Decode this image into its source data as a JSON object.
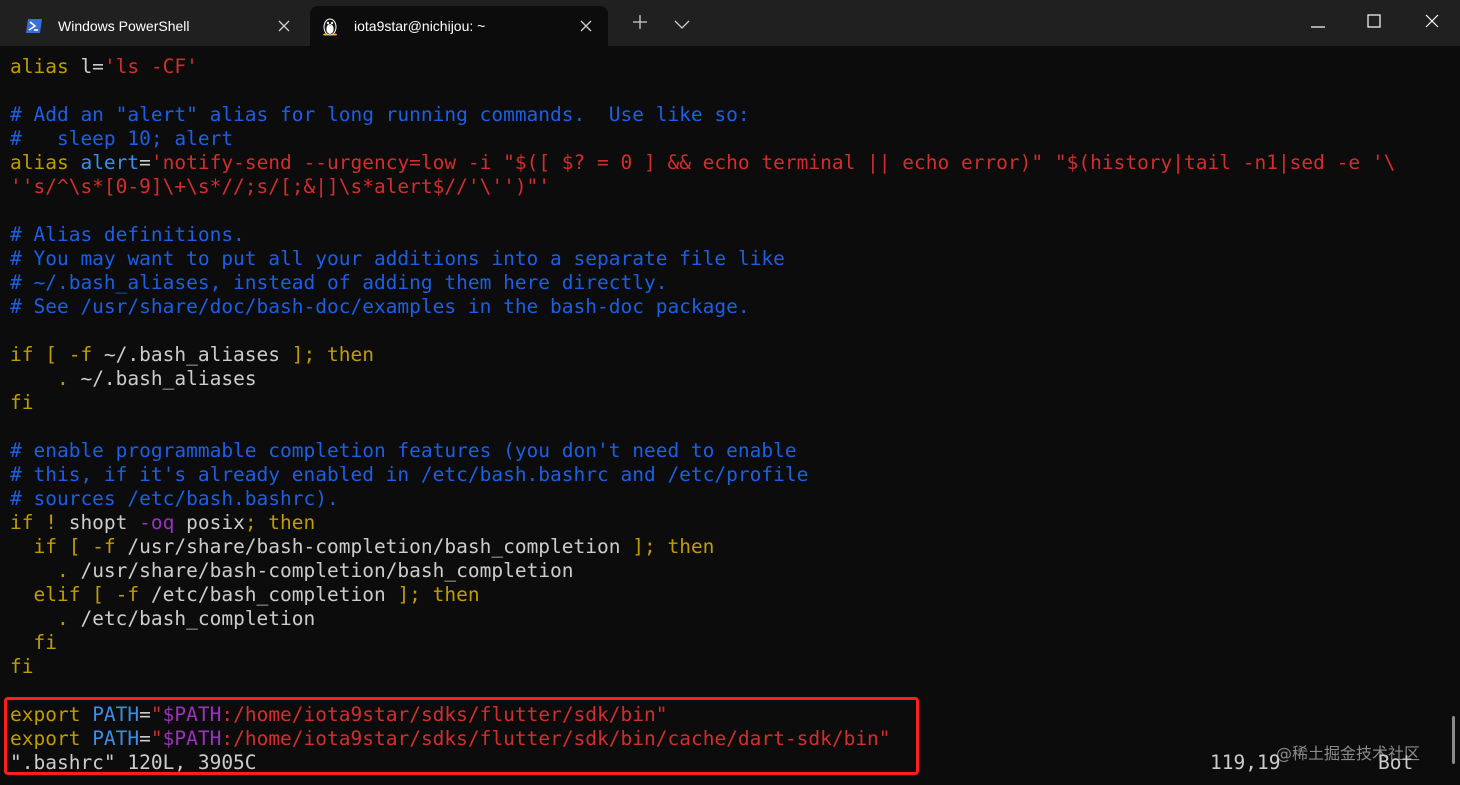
{
  "tabs": [
    {
      "label": "Windows PowerShell",
      "icon": "powershell-icon"
    },
    {
      "label": "iota9star@nichijou: ~",
      "icon": "linux-tux-icon"
    }
  ],
  "colors": {
    "comment": "#1b5fe6",
    "keyword": "#c19c00",
    "string": "#d42d2d",
    "variable": "#9a33c0",
    "identifier": "#3b8eea",
    "text": "#cccccc",
    "highlight_box": "#ff1e1e",
    "background": "#0c0c0c",
    "titlebar": "#202020"
  },
  "code": {
    "l1": {
      "kw": "alias",
      "name": " l=",
      "str": "'ls -CF'"
    },
    "l2": {
      "text": "# Add an \"alert\" alias for long running commands.  Use like so:"
    },
    "l3": {
      "text": "#   sleep 10; alert"
    },
    "l4": {
      "kw": "alias ",
      "name": "alert",
      "eq": "=",
      "str": "'notify-send --urgency=low -i \"$([ $? = 0 ] && echo terminal || echo error)\" \"$(history|tail -n1|sed -e '\\"
    },
    "l5": {
      "str": "''s/^\\s*[0-9]\\+\\s*//;s/[;&|]\\s*alert$//'\\'')\"'"
    },
    "l6": {
      "text": "# Alias definitions."
    },
    "l7": {
      "text": "# You may want to put all your additions into a separate file like"
    },
    "l8": {
      "text": "# ~/.bash_aliases, instead of adding them here directly."
    },
    "l9": {
      "text": "# See /usr/share/doc/bash-doc/examples in the bash-doc package."
    },
    "l10": {
      "kw1": "if [ -f ",
      "path": "~/.bash_aliases",
      "kw2": " ]; then"
    },
    "l11": {
      "dot": "    . ",
      "path": "~/.bash_aliases"
    },
    "l12": {
      "kw": "fi"
    },
    "l13": {
      "text": "# enable programmable completion features (you don't need to enable"
    },
    "l14": {
      "text": "# this, if it's already enabled in /etc/bash.bashrc and /etc/profile"
    },
    "l15": {
      "text": "# sources /etc/bash.bashrc)."
    },
    "l16": {
      "kw1": "if ! ",
      "cmd": "shopt",
      "opt": " -oq",
      "arg": " posix",
      "kw2": "; then"
    },
    "l17": {
      "kw1": "  if [ -f ",
      "path": "/usr/share/bash-completion/bash_completion",
      "kw2": " ]; then"
    },
    "l18": {
      "dot": "    . ",
      "path": "/usr/share/bash-completion/bash_completion"
    },
    "l19": {
      "kw1": "  elif [ -f ",
      "path": "/etc/bash_completion",
      "kw2": " ]; then"
    },
    "l20": {
      "dot": "    . ",
      "path": "/etc/bash_completion"
    },
    "l21": {
      "kw": "  fi"
    },
    "l22": {
      "kw": "fi"
    },
    "l23": {
      "kw": "export ",
      "name": "PATH",
      "eq": "=",
      "q1": "\"",
      "var": "$PATH",
      "str": ":/home/iota9star/sdks/flutter/sdk/bin\""
    },
    "l24": {
      "kw": "export ",
      "name": "PATH",
      "eq": "=",
      "q1": "\"",
      "var": "$PATH",
      "str": ":/home/iota9star/sdks/flutter/sdk/bin/cache/dart-sdk/bin\""
    }
  },
  "status": {
    "file_info": "\".bashrc\" 120L, 3905C",
    "position": "119,19",
    "scroll": "Bot"
  },
  "watermark": "@稀土掘金技术社区"
}
